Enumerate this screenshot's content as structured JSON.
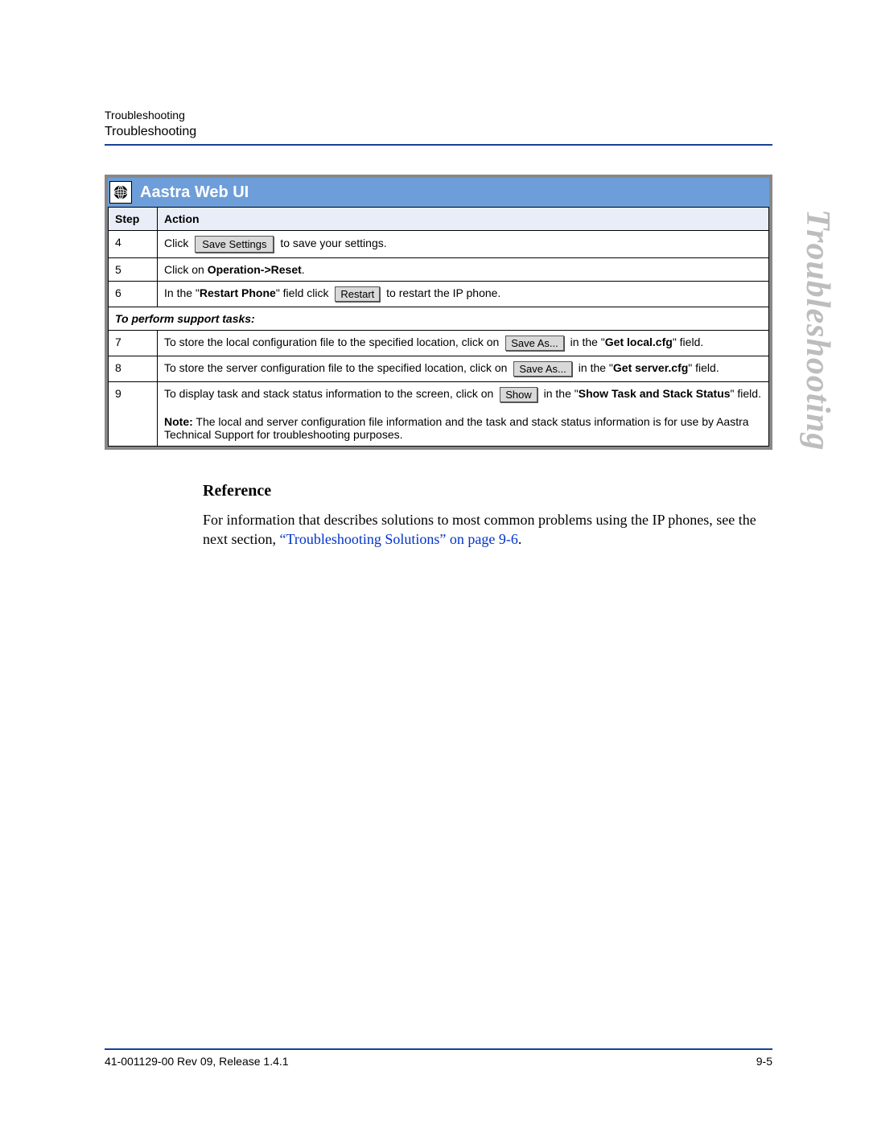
{
  "header": {
    "bc1": "Troubleshooting",
    "bc2": "Troubleshooting"
  },
  "sidetab": "Troubleshooting",
  "box_title": "Aastra Web UI",
  "cols": {
    "step": "Step",
    "action": "Action"
  },
  "rows": {
    "r4": {
      "n": "4",
      "pre": "Click",
      "btn": "Save Settings",
      "post": " to save your settings."
    },
    "r5": {
      "n": "5",
      "a": "Click on ",
      "b": "Operation->Reset",
      "c": "."
    },
    "r6": {
      "n": "6",
      "a": "In the \"",
      "b": "Restart Phone",
      "c": "\" field click",
      "btn": "Restart",
      "post": " to restart the IP phone."
    },
    "sub": "To perform support tasks:",
    "r7": {
      "n": "7",
      "a": "To store the local configuration file to the specified location, click on",
      "btn": "Save As...",
      "b": " in the \"",
      "c": "Get local.cfg",
      "d": "\" field."
    },
    "r8": {
      "n": "8",
      "a": "To store the server configuration file to the specified location, click on",
      "btn": "Save As...",
      "b": " in the \"",
      "c": "Get server.cfg",
      "d": "\" field."
    },
    "r9": {
      "n": "9",
      "a": "To display task and stack status information to the screen, click on",
      "btn": "Show",
      "b": " in the \"",
      "c": "Show Task and Stack Status",
      "d": "\" field.",
      "note_l": "Note:",
      "note": " The local and server configuration file information and the task and stack status information is for use by Aastra Technical Support for troubleshooting purposes."
    }
  },
  "ref": {
    "h": "Reference",
    "p1": "For information that describes solutions to most common problems using the IP phones, see the next section, ",
    "link1": "“Troubleshooting Solutions”",
    "mid": " on ",
    "link2": "page 9-6",
    "end": "."
  },
  "footer": {
    "left": "41-001129-00 Rev 09, Release 1.4.1",
    "right": "9-5"
  }
}
